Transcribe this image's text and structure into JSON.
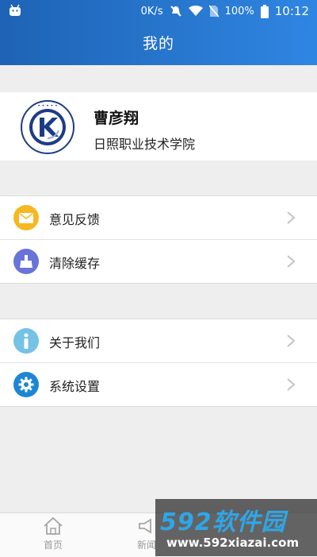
{
  "status_bar": {
    "speed": "0K/s",
    "battery": "100%",
    "time": "10:12"
  },
  "header": {
    "title": "我的"
  },
  "profile": {
    "name": "曹彦翔",
    "school": "日照职业技术学院"
  },
  "menu_group_1": [
    {
      "label": "意见反馈",
      "icon": "mail-icon",
      "color": "#f6b820"
    },
    {
      "label": "清除缓存",
      "icon": "broom-icon",
      "color": "#6a73d8"
    }
  ],
  "menu_group_2": [
    {
      "label": "关于我们",
      "icon": "info-icon",
      "color": "#74c2e6"
    },
    {
      "label": "系统设置",
      "icon": "gear-icon",
      "color": "#1d86d4"
    }
  ],
  "bottom_nav": {
    "home_label": "首页",
    "news_label": "新闻"
  },
  "watermark": {
    "brand": "592软件园",
    "url": "www.592xiazai.com"
  },
  "colors": {
    "header_start": "#1e63b5",
    "header_end": "#2f86e2",
    "background": "#eeeeee"
  }
}
